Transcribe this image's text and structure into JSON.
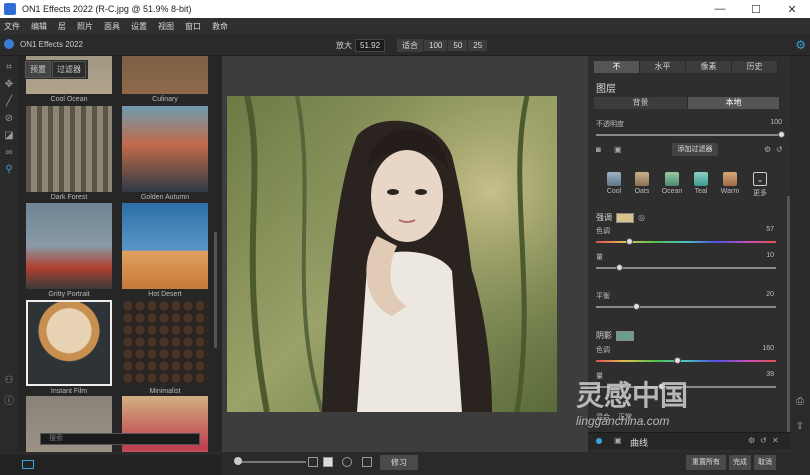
{
  "window": {
    "title": "ON1 Effects 2022 (R-C.jpg @ 51.9% 8-bit)"
  },
  "menu": [
    "文件",
    "编辑",
    "层",
    "照片",
    "面具",
    "设置",
    "视图",
    "窗口",
    "救命"
  ],
  "brand": "ON1 Effects 2022",
  "zoom": {
    "label": "放大",
    "value": "51.92",
    "fit": "适合",
    "z100": "100",
    "z50": "50",
    "z25": "25"
  },
  "browser": {
    "tabs": [
      "预置",
      "过滤器"
    ],
    "items": [
      "Cool Ocean",
      "Culinary",
      "Dark Forest",
      "Golden Autumn",
      "Gritty Portrait",
      "Hot Desert",
      "Instant Film",
      "Minimalist"
    ],
    "search_placeholder": "搜索"
  },
  "panel": {
    "mode_tabs": [
      "不",
      "水平",
      "像素",
      "历史"
    ],
    "section_title": "图层",
    "blend_tabs": [
      "背景",
      "本地"
    ],
    "opacity_label": "不透明度",
    "opacity_value": "100",
    "add_filter": "添加过滤器",
    "presets": [
      "Cool",
      "Oats",
      "Ocean",
      "Teal",
      "Warm",
      "更多"
    ],
    "highlights": {
      "label": "强调",
      "hue_label": "色调",
      "hue_value": "57",
      "amount_label": "量",
      "amount_value": "10"
    },
    "balance": {
      "label": "平衡",
      "value": "20"
    },
    "shadows": {
      "label": "阴影",
      "hue_label": "色调",
      "hue_value": "160",
      "amount_label": "量",
      "amount_value": "39"
    },
    "curves": "曲线",
    "blend_mode": "混合",
    "blend_value": "正常"
  },
  "bottom": {
    "retouch": "修习"
  },
  "actions": [
    "重置所有",
    "完成",
    "取消"
  ],
  "watermark": {
    "text": "灵感中国",
    "url": "lingganchina.com"
  },
  "colors": {
    "accent": "#3aa0e0",
    "highlight_swatch": "#d8c48a",
    "shadow_swatch": "#6a9e8e"
  }
}
